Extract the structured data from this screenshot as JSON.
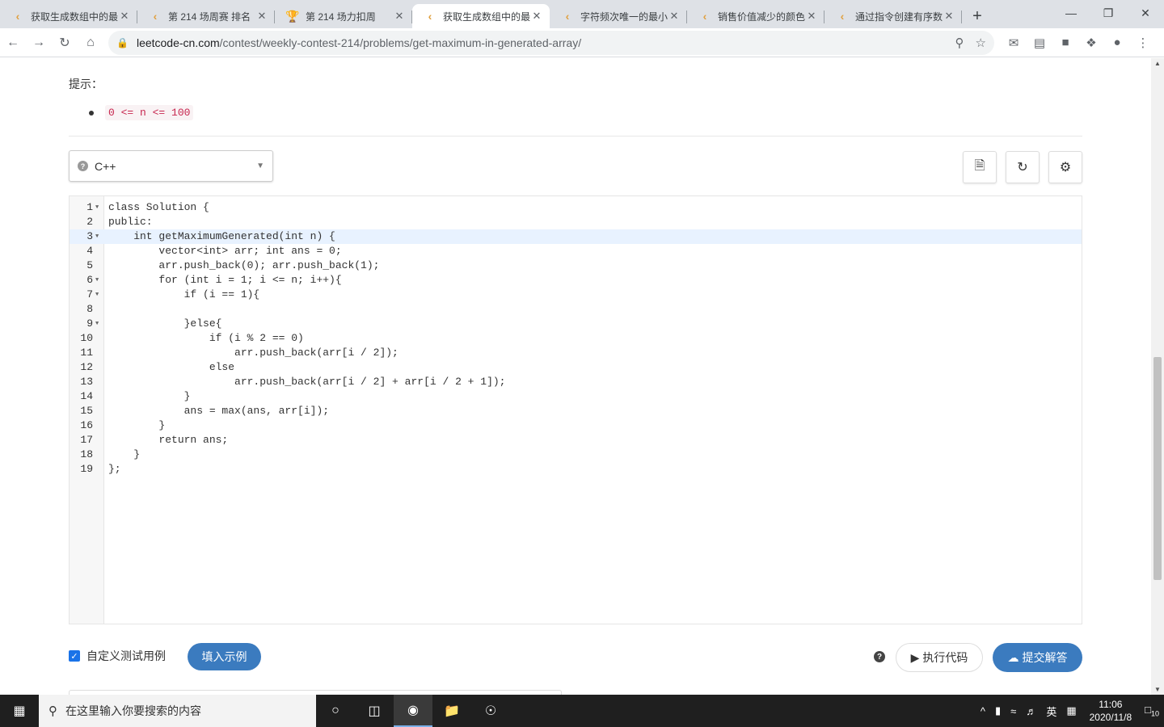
{
  "browser": {
    "tabs": [
      {
        "title": "获取生成数组中的最",
        "active": false,
        "favicon": "leetcode-icon"
      },
      {
        "title": "第 214 场周赛 排名",
        "active": false,
        "favicon": "leetcode-icon"
      },
      {
        "title": "第 214 场力扣周",
        "active": false,
        "favicon": "trophy-icon"
      },
      {
        "title": "获取生成数组中的最",
        "active": true,
        "favicon": "leetcode-icon"
      },
      {
        "title": "字符频次唯一的最小",
        "active": false,
        "favicon": "leetcode-icon"
      },
      {
        "title": "销售价值减少的颜色",
        "active": false,
        "favicon": "leetcode-icon"
      },
      {
        "title": "通过指令创建有序数",
        "active": false,
        "favicon": "leetcode-icon"
      }
    ],
    "url_host": "leetcode-cn.com",
    "url_path": "/contest/weekly-contest-214/problems/get-maximum-in-generated-array/"
  },
  "hints": {
    "title": "提示：",
    "items": [
      "0 <= n <= 100"
    ]
  },
  "editor": {
    "language": "C++",
    "lines": [
      {
        "n": "1",
        "fold": true,
        "code": "class Solution {"
      },
      {
        "n": "2",
        "fold": false,
        "code": "public:"
      },
      {
        "n": "3",
        "fold": true,
        "code": "    int getMaximumGenerated(int n) {",
        "active": true
      },
      {
        "n": "4",
        "fold": false,
        "code": "        vector<int> arr; int ans = 0;"
      },
      {
        "n": "5",
        "fold": false,
        "code": "        arr.push_back(0); arr.push_back(1);"
      },
      {
        "n": "6",
        "fold": true,
        "code": "        for (int i = 1; i <= n; i++){"
      },
      {
        "n": "7",
        "fold": true,
        "code": "            if (i == 1){"
      },
      {
        "n": "8",
        "fold": false,
        "code": ""
      },
      {
        "n": "9",
        "fold": true,
        "code": "            }else{"
      },
      {
        "n": "10",
        "fold": false,
        "code": "                if (i % 2 == 0)"
      },
      {
        "n": "11",
        "fold": false,
        "code": "                    arr.push_back(arr[i / 2]);"
      },
      {
        "n": "12",
        "fold": false,
        "code": "                else"
      },
      {
        "n": "13",
        "fold": false,
        "code": "                    arr.push_back(arr[i / 2] + arr[i / 2 + 1]);"
      },
      {
        "n": "14",
        "fold": false,
        "code": "            }"
      },
      {
        "n": "15",
        "fold": false,
        "code": "            ans = max(ans, arr[i]);"
      },
      {
        "n": "16",
        "fold": false,
        "code": "        }"
      },
      {
        "n": "17",
        "fold": false,
        "code": "        return ans;"
      },
      {
        "n": "18",
        "fold": false,
        "code": "    }"
      },
      {
        "n": "19",
        "fold": false,
        "code": "};"
      }
    ]
  },
  "actions": {
    "custom_test_label": "自定义测试用例",
    "custom_test_checked": true,
    "fill_example_label": "填入示例",
    "run_label": "执行代码",
    "submit_label": "提交解答"
  },
  "taskbar": {
    "search_placeholder": "在这里输入你要搜索的内容",
    "ime": "英",
    "time": "11:06",
    "date": "2020/11/8",
    "notifications": "10"
  },
  "colors": {
    "accent": "#3b7bbf",
    "active_line": "#e8f2ff"
  }
}
